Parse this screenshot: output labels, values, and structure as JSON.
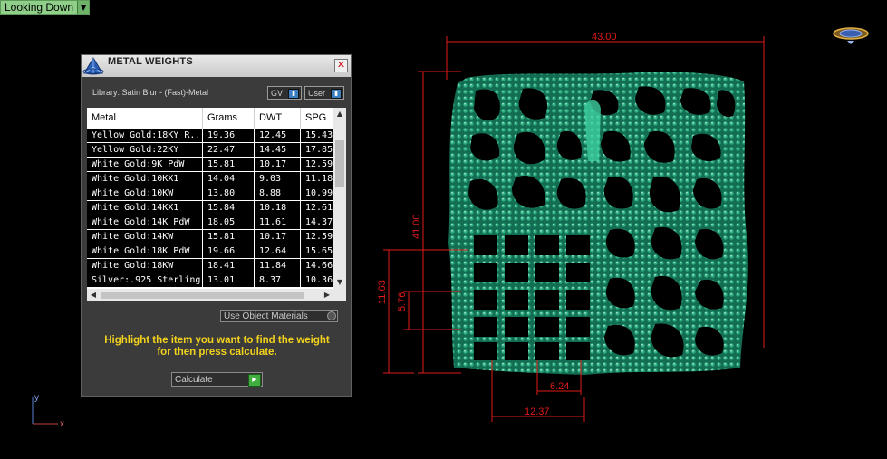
{
  "view": {
    "label": "Looking Down",
    "dropdown_icon": "triangle-down-icon"
  },
  "panel": {
    "title": "METAL WEIGHTS",
    "close_icon": "close-x-icon",
    "library_label": "Library: Satin Blur - (Fast)-Metal",
    "gv_label": "GV",
    "user_label": "User",
    "columns": [
      "Metal",
      "Grams",
      "DWT",
      "SPG"
    ],
    "rows": [
      {
        "metal": "Yellow Gold:18KY R...",
        "grams": "19.36",
        "dwt": "12.45",
        "spg": "15.43"
      },
      {
        "metal": "Yellow Gold:22KY",
        "grams": "22.47",
        "dwt": "14.45",
        "spg": "17.85"
      },
      {
        "metal": "White Gold:9K PdW",
        "grams": "15.81",
        "dwt": "10.17",
        "spg": "12.59"
      },
      {
        "metal": "White Gold:10KX1",
        "grams": "14.04",
        "dwt": "9.03",
        "spg": "11.18"
      },
      {
        "metal": "White Gold:10KW",
        "grams": "13.80",
        "dwt": "8.88",
        "spg": "10.99"
      },
      {
        "metal": "White Gold:14KX1",
        "grams": "15.84",
        "dwt": "10.18",
        "spg": "12.61"
      },
      {
        "metal": "White Gold:14K PdW",
        "grams": "18.05",
        "dwt": "11.61",
        "spg": "14.37"
      },
      {
        "metal": "White Gold:14KW",
        "grams": "15.81",
        "dwt": "10.17",
        "spg": "12.59"
      },
      {
        "metal": "White Gold:18K PdW",
        "grams": "19.66",
        "dwt": "12.64",
        "spg": "15.65"
      },
      {
        "metal": "White Gold:18KW",
        "grams": "18.41",
        "dwt": "11.84",
        "spg": "14.66"
      },
      {
        "metal": "Silver:.925 Sterling",
        "grams": "13.01",
        "dwt": "8.37",
        "spg": "10.36"
      }
    ],
    "use_object_materials": "Use Object Materials",
    "help_text_line1": "Highlight the item you want to find the weight",
    "help_text_line2": "for then press calculate.",
    "calculate_label": "Calculate"
  },
  "dimensions": {
    "width": "43.00",
    "height": "41.00",
    "left_outer": "11.63",
    "left_inner": "5.76",
    "bottom_inner": "6.24",
    "bottom_outer": "12.37"
  },
  "axis": {
    "x": "x",
    "y": "y"
  },
  "colors": {
    "mesh": "#1a8a66",
    "dimension": "#e01a1a",
    "help_text": "#f2d21c",
    "view_label_bg": "#8fcf8a"
  }
}
